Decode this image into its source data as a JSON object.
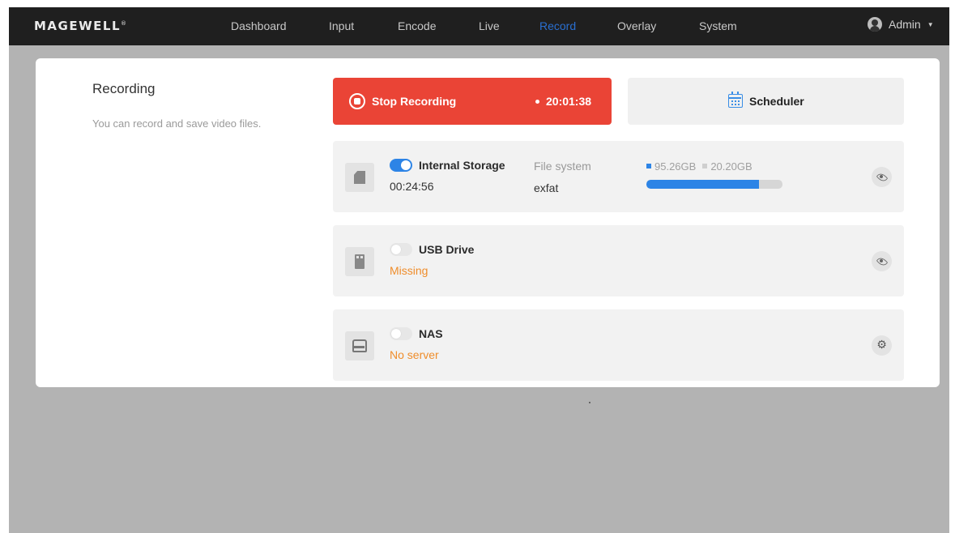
{
  "brand": {
    "logo": "MAGEWELL",
    "mark": "®"
  },
  "nav": {
    "items": [
      "Dashboard",
      "Input",
      "Encode",
      "Live",
      "Record",
      "Overlay",
      "System"
    ],
    "active": "Record"
  },
  "user": {
    "name": "Admin",
    "caret": "▼"
  },
  "recording": {
    "title": "Recording",
    "description": "You can record and save video files.",
    "stop_label": "Stop Recording",
    "elapsed": "20:01:38",
    "scheduler_label": "Scheduler"
  },
  "storages": [
    {
      "name": "Internal Storage",
      "enabled": true,
      "status": "00:24:56",
      "status_kind": "normal",
      "filesystem_label": "File system",
      "filesystem": "exfat",
      "total": "95.26GB",
      "free": "20.20GB",
      "used_fraction": 0.83,
      "icon": "sd-card-icon"
    },
    {
      "name": "USB Drive",
      "enabled": false,
      "status": "Missing",
      "status_kind": "warning",
      "icon": "usb-drive-icon"
    },
    {
      "name": "NAS",
      "enabled": false,
      "status": "No server",
      "status_kind": "warning",
      "icon": "nas-icon"
    }
  ],
  "colors": {
    "accent": "#2d84e6",
    "stop": "#ea4436",
    "warning": "#ef8d2b",
    "active_nav": "#2a6fd1"
  }
}
